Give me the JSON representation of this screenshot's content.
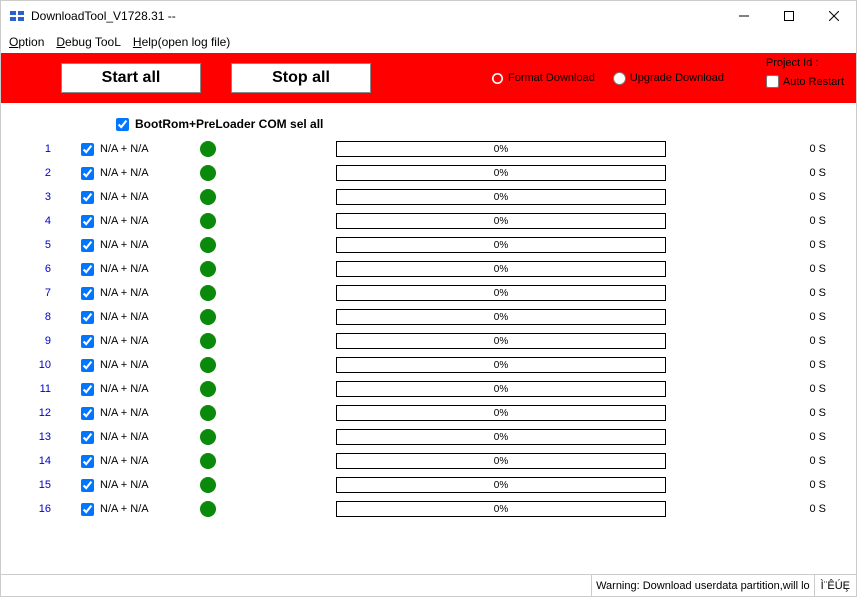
{
  "window": {
    "title": "DownloadTool_V1728.31 --"
  },
  "menu": {
    "option": "Option",
    "debug": "Debug TooL",
    "help": "Help(open log file)"
  },
  "toolbar": {
    "start_label": "Start all",
    "stop_label": "Stop all",
    "format_label": "Format Download",
    "upgrade_label": "Upgrade Download",
    "project_id_label": "Project Id :",
    "auto_restart_label": "Auto Restart"
  },
  "sel_all_label": "BootRom+PreLoader COM sel all",
  "rows": [
    {
      "num": "1",
      "label": "N/A + N/A",
      "progress": "0%",
      "time": "0 S"
    },
    {
      "num": "2",
      "label": "N/A + N/A",
      "progress": "0%",
      "time": "0 S"
    },
    {
      "num": "3",
      "label": "N/A + N/A",
      "progress": "0%",
      "time": "0 S"
    },
    {
      "num": "4",
      "label": "N/A + N/A",
      "progress": "0%",
      "time": "0 S"
    },
    {
      "num": "5",
      "label": "N/A + N/A",
      "progress": "0%",
      "time": "0 S"
    },
    {
      "num": "6",
      "label": "N/A + N/A",
      "progress": "0%",
      "time": "0 S"
    },
    {
      "num": "7",
      "label": "N/A + N/A",
      "progress": "0%",
      "time": "0 S"
    },
    {
      "num": "8",
      "label": "N/A + N/A",
      "progress": "0%",
      "time": "0 S"
    },
    {
      "num": "9",
      "label": "N/A + N/A",
      "progress": "0%",
      "time": "0 S"
    },
    {
      "num": "10",
      "label": "N/A + N/A",
      "progress": "0%",
      "time": "0 S"
    },
    {
      "num": "11",
      "label": "N/A + N/A",
      "progress": "0%",
      "time": "0 S"
    },
    {
      "num": "12",
      "label": "N/A + N/A",
      "progress": "0%",
      "time": "0 S"
    },
    {
      "num": "13",
      "label": "N/A + N/A",
      "progress": "0%",
      "time": "0 S"
    },
    {
      "num": "14",
      "label": "N/A + N/A",
      "progress": "0%",
      "time": "0 S"
    },
    {
      "num": "15",
      "label": "N/A + N/A",
      "progress": "0%",
      "time": "0 S"
    },
    {
      "num": "16",
      "label": "N/A + N/A",
      "progress": "0%",
      "time": "0 S"
    }
  ],
  "status": {
    "warning": "Warning: Download userdata partition,will lo",
    "tail": "Ì¨ÊÚȨ"
  }
}
